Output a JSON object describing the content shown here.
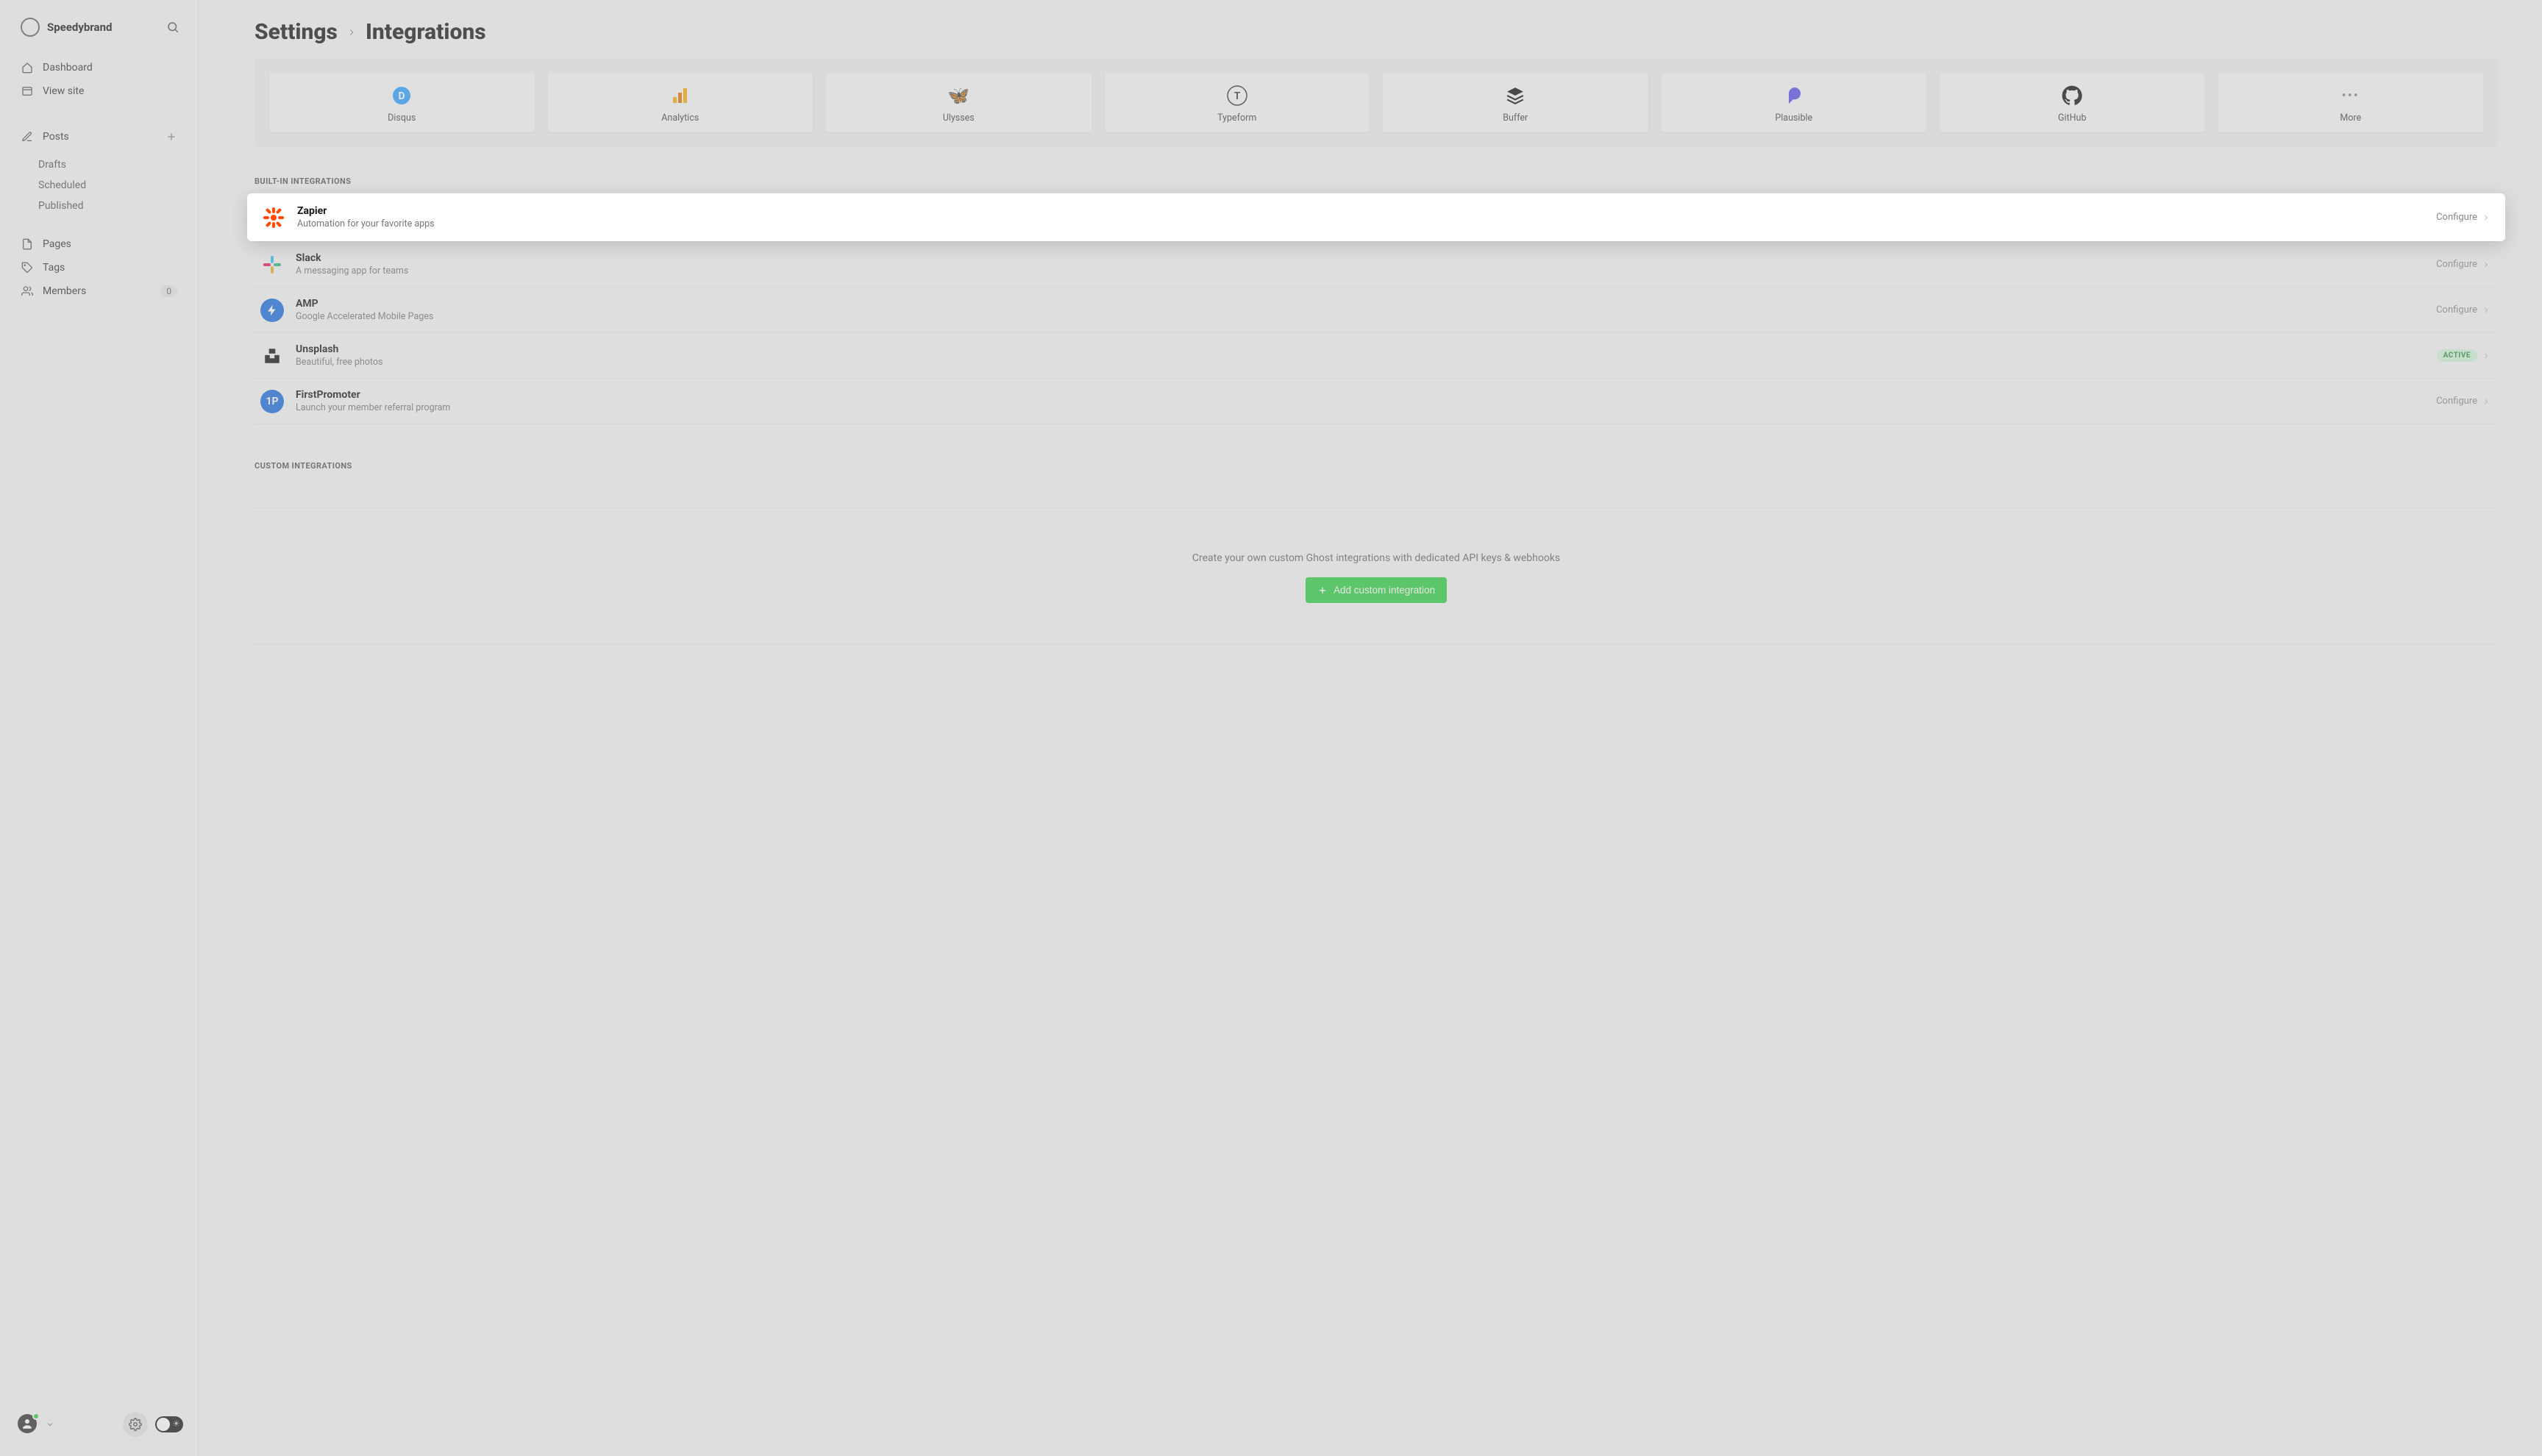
{
  "site_name": "Speedybrand",
  "sidebar": {
    "dashboard": "Dashboard",
    "view_site": "View site",
    "posts": "Posts",
    "drafts": "Drafts",
    "scheduled": "Scheduled",
    "published": "Published",
    "pages": "Pages",
    "tags": "Tags",
    "members": "Members",
    "members_count": "0"
  },
  "breadcrumb": {
    "settings": "Settings",
    "integrations": "Integrations"
  },
  "gallery": {
    "disqus": "Disqus",
    "analytics": "Analytics",
    "ulysses": "Ulysses",
    "typeform": "Typeform",
    "buffer": "Buffer",
    "plausible": "Plausible",
    "github": "GitHub",
    "more": "More"
  },
  "sections": {
    "builtin_heading": "Built-in integrations",
    "custom_heading": "Custom integrations"
  },
  "integrations": {
    "zapier": {
      "name": "Zapier",
      "desc": "Automation for your favorite apps",
      "action": "Configure"
    },
    "slack": {
      "name": "Slack",
      "desc": "A messaging app for teams",
      "action": "Configure"
    },
    "amp": {
      "name": "AMP",
      "desc": "Google Accelerated Mobile Pages",
      "action": "Configure"
    },
    "unsplash": {
      "name": "Unsplash",
      "desc": "Beautiful, free photos",
      "badge": "ACTIVE"
    },
    "firstpromoter": {
      "name": "FirstPromoter",
      "desc": "Launch your member referral program",
      "action": "Configure"
    }
  },
  "custom": {
    "empty_text": "Create your own custom Ghost integrations with dedicated API keys & webhooks",
    "add_button": "Add custom integration"
  }
}
